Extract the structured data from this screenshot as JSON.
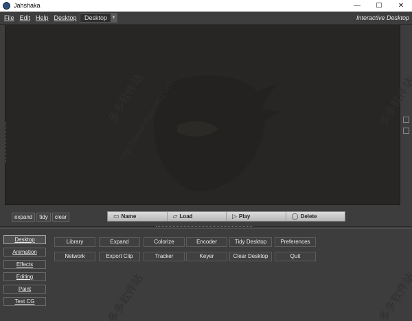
{
  "window": {
    "title": "Jahshaka",
    "controls": [
      "—",
      "☐",
      "✕"
    ]
  },
  "menubar": {
    "items": [
      "File",
      "Edit",
      "Help",
      "Desktop"
    ],
    "desktop_select": "Desktop",
    "mode_label": "Interactive Desktop"
  },
  "watermark": {
    "chinese": "多多软件站",
    "url": "http://www.duoooo.com"
  },
  "mini_buttons": [
    "expand",
    "tidy",
    "clear"
  ],
  "playbar": {
    "name": "Name",
    "load": "Load",
    "play": "Play",
    "delete": "Delete"
  },
  "nav": {
    "items": [
      "Desktop",
      "Animation",
      "Effects",
      "Editing",
      "Paint",
      "Text CG"
    ],
    "active": "Desktop"
  },
  "grid": {
    "row1": [
      "Library",
      "Expand",
      "Colorize",
      "Encoder",
      "Tidy Desktop",
      "Preferences"
    ],
    "row2": [
      "Network",
      "Export Clip",
      "Tracker",
      "Keyer",
      "Clear Desktop",
      "Quit"
    ]
  },
  "colors": {
    "background": "#3d3d3d",
    "viewport": "#272624",
    "playbar": "#cfcfcf"
  }
}
